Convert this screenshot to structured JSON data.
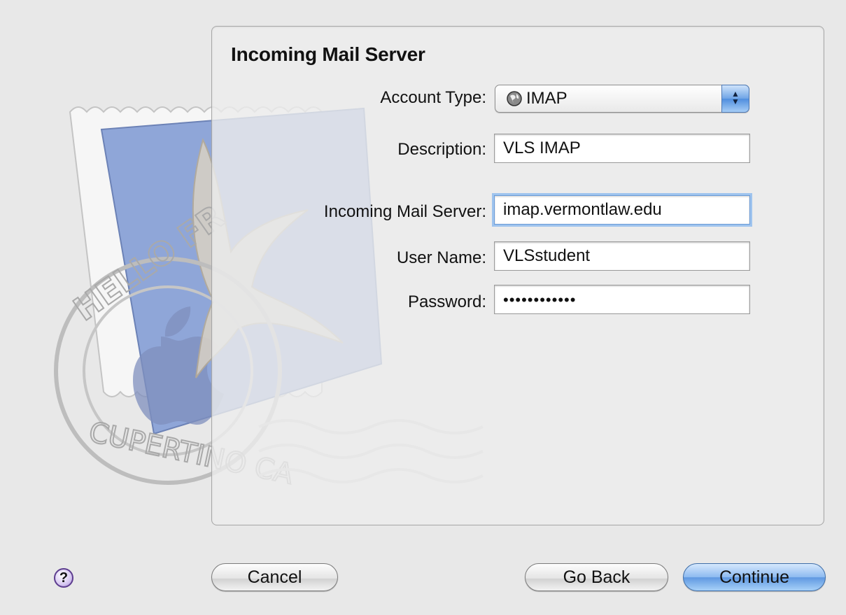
{
  "panel": {
    "title": "Incoming Mail Server",
    "stamp_postmark_text": "HELLO FROM CUPERTINO CA"
  },
  "form": {
    "account_type": {
      "label": "Account Type:",
      "value": "IMAP",
      "icon": "globe-icon"
    },
    "description": {
      "label": "Description:",
      "value": "VLS IMAP"
    },
    "incoming_server": {
      "label": "Incoming Mail Server:",
      "value": "imap.vermontlaw.edu"
    },
    "user_name": {
      "label": "User Name:",
      "value": "VLSstudent"
    },
    "password": {
      "label": "Password:",
      "value": "••••••••••••"
    }
  },
  "buttons": {
    "help": "?",
    "cancel": "Cancel",
    "go_back": "Go Back",
    "continue": "Continue"
  },
  "colors": {
    "focus_ring": "#9fc4ee",
    "default_button": "#5f98e1",
    "stamp_blue": "#8fa6d8"
  }
}
